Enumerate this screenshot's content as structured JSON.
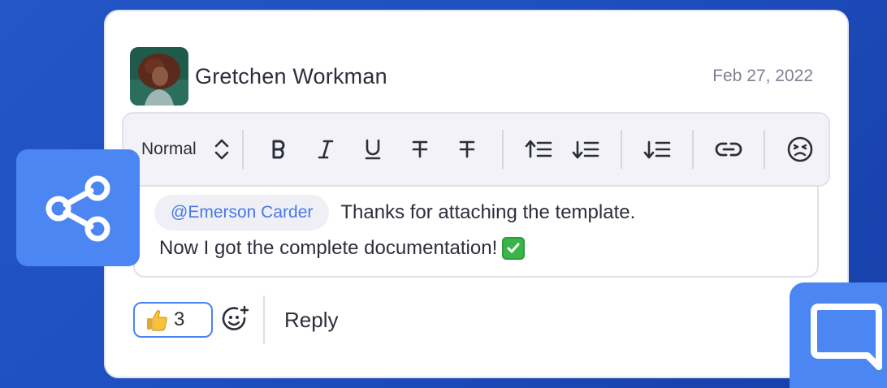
{
  "comment": {
    "author": "Gretchen Workman",
    "date": "Feb 27, 2022",
    "mention": "@Emerson Carder",
    "message_line1": "Thanks for attaching the template.",
    "message_line2": "Now I got the complete documentation!"
  },
  "toolbar": {
    "style_select": "Normal",
    "buttons": [
      "bold-icon",
      "italic-icon",
      "underline-icon",
      "strikethrough-icon",
      "strikethrough-alt-icon",
      "list-ascending-icon",
      "list-descending-icon",
      "list-sorted-icon",
      "link-icon",
      "emoji-icon"
    ]
  },
  "reactions": {
    "thumbs_up_count": "3"
  },
  "actions": {
    "reply_label": "Reply"
  },
  "colors": {
    "accent": "#4b86f2",
    "background": "#1e4fc0",
    "mention_text": "#4a78e8",
    "text": "#2c2f3a",
    "muted": "#7d8093"
  }
}
